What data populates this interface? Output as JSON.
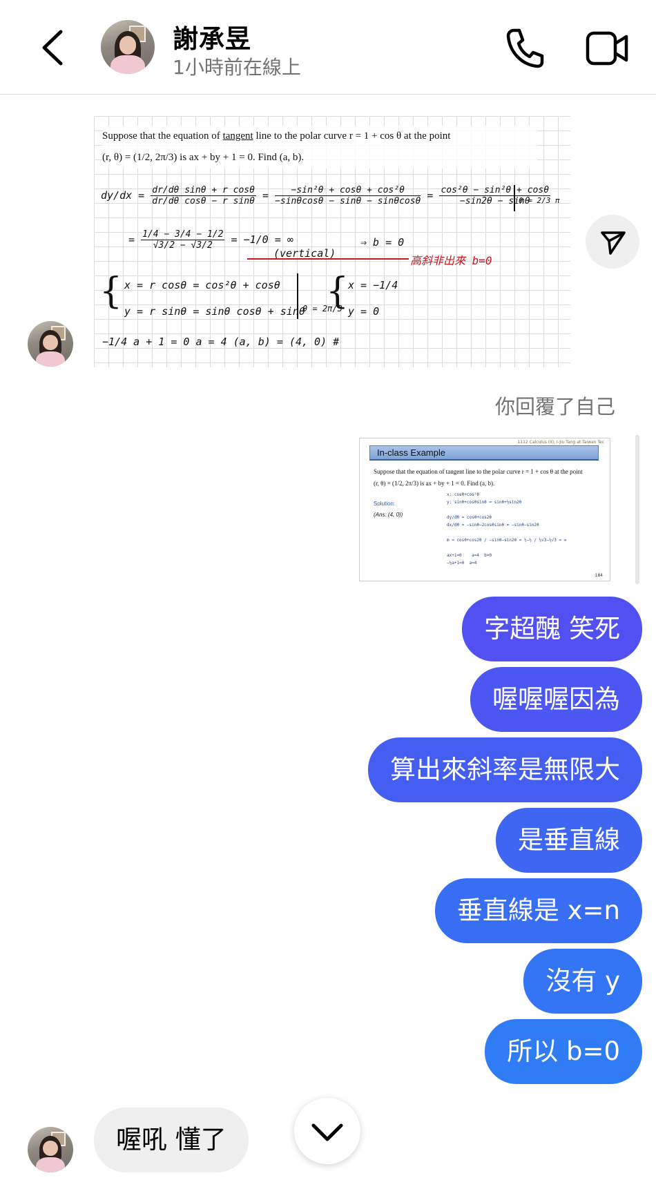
{
  "header": {
    "contact_name": "謝承昱",
    "status": "1小時前在線上",
    "back_icon": "chevron-left-icon",
    "call_icon": "phone-icon",
    "video_icon": "video-camera-icon"
  },
  "image_message_1": {
    "question_line1_a": "Suppose that the equation of ",
    "question_line1_b": "tangent",
    "question_line1_c": " line to the polar curve r = 1 + cos θ at the point",
    "question_line2": "(r, θ) = (1/2, 2π/3) is ax + by + 1 = 0. Find (a, b).",
    "line1_lhs": "dy/dx =",
    "line1_num_a": "dr/dθ sinθ + r cosθ",
    "line1_den_a": "dr/dθ cosθ − r sinθ",
    "line1_num_b": "−sin²θ + cosθ + cos²θ",
    "line1_den_b": "−sinθcosθ − sinθ − sinθcosθ",
    "line1_num_c": "cos²θ − sin²θ + cosθ",
    "line1_den_c": "−sin2θ − sinθ",
    "line1_eval": "θ = 2/3 π",
    "line2_num": "1/4 − 3/4 − 1/2",
    "line2_den": "√3/2 − √3/2",
    "line2_rest": "= −1/0 = ∞",
    "vertical_label": "(vertical)",
    "implies": "⇒ b = 0",
    "red_note": "高斜非出來 b=0",
    "x_eq": "x = r cosθ  =  cos²θ + cosθ",
    "y_eq": "y = r sinθ  =  sinθ cosθ + sinθ",
    "theta_eval": "θ = 2π/3",
    "x_val": "x = −1/4",
    "y_val": "y = 0",
    "last_line": "−1/4 a + 1 = 0     a = 4      (a, b) = (4, 0) #"
  },
  "share_icon": "paper-plane-icon",
  "reply_label": "你回覆了自己",
  "image_message_2": {
    "course_tag": "1112 Calculus (II), I-Jiu Tang at Taiwan Tec",
    "title": "In-class Example",
    "question_line1": "Suppose that the equation of tangent line to the polar curve r = 1 + cos θ at the point",
    "question_line2": "(r, θ) = (1/2, 2π/3) is ax + by + 1 = 0. Find (a, b).",
    "solution_label": "Solution:",
    "answer_label": "(Ans: (4, 0))",
    "work": "x: cosθ+cos²θ\ny: sinθ+cosθsinθ = sinθ+½sin2θ\n\ndy/dθ = cosθ+cos2θ\ndx/dθ = −sinθ−2cosθsinθ = −sinθ−sin2θ\n\nm = cosθ+cos2θ / −sinθ−sin2θ = ½−½ / ½√3−½√3 = ∞\n\nax+1=0    a=4  b=0\n−¼a+1=0  a=4",
    "page_number": "184"
  },
  "outgoing_messages": [
    "字超醜 笑死",
    "喔喔喔因為",
    "算出來斜率是無限大",
    "是垂直線",
    "垂直線是 x=n",
    "沒有 y",
    "所以 b=0"
  ],
  "incoming_message": "喔吼 懂了",
  "scroll_down_icon": "chevron-down-icon",
  "colors": {
    "bubble_gradient_top": "#5a50f0",
    "bubble_gradient_bottom": "#2f7cf5",
    "incoming_bubble": "#efefef",
    "secondary_text": "#737373",
    "red_ink": "#c8161d"
  }
}
